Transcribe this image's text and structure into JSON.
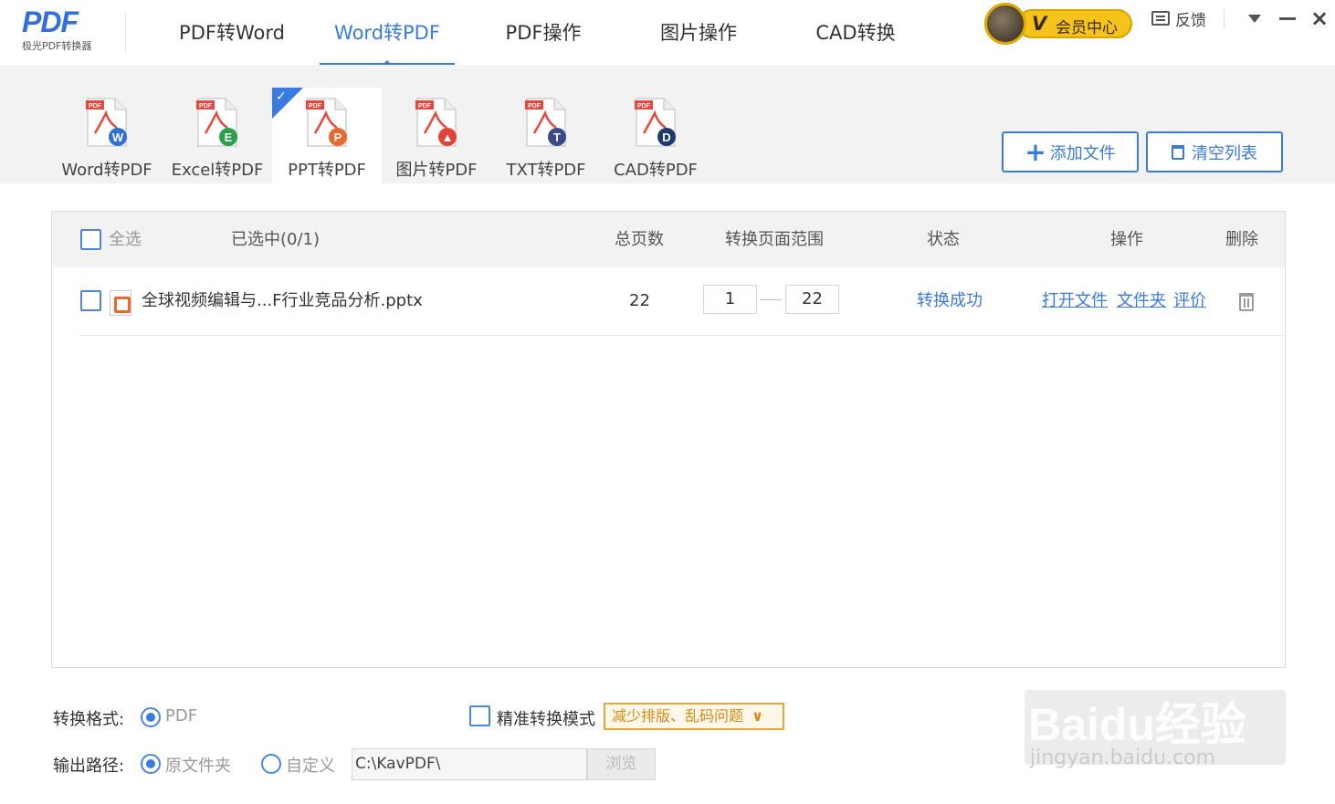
{
  "header": {
    "logo_main": "PDF",
    "logo_sub": "极光PDF转换器",
    "tabs": [
      "PDF转Word",
      "Word转PDF",
      "PDF操作",
      "图片操作",
      "CAD转换"
    ],
    "active_tab": 1,
    "vip_v": "V",
    "vip_label": "会员中心",
    "feedback_label": "反馈"
  },
  "subtabs": {
    "items": [
      {
        "label": "Word转PDF",
        "badge": "W",
        "color": "#2f6fd6"
      },
      {
        "label": "Excel转PDF",
        "badge": "E",
        "color": "#2aa04a"
      },
      {
        "label": "PPT转PDF",
        "badge": "P",
        "color": "#e8692e"
      },
      {
        "label": "图片转PDF",
        "badge": "▲",
        "color": "#e0443c"
      },
      {
        "label": "TXT转PDF",
        "badge": "T",
        "color": "#3b4a8a"
      },
      {
        "label": "CAD转PDF",
        "badge": "D",
        "color": "#1f3a6a"
      }
    ],
    "active": 2,
    "doc_tag": "PDF",
    "accent_color": "#3a7be0"
  },
  "toolbar": {
    "add_label": "添加文件",
    "clear_label": "清空列表"
  },
  "list": {
    "headers": {
      "select_all": "全选",
      "selected": "已选中(0/1)",
      "pages": "总页数",
      "range": "转换页面范围",
      "status": "状态",
      "actions": "操作",
      "delete": "删除"
    },
    "rows": [
      {
        "filename": "全球视频编辑与...F行业竞品分析.pptx",
        "pages": "22",
        "range_start": "1",
        "range_end": "22",
        "status": "转换成功",
        "action_open": "打开文件",
        "action_folder": "文件夹",
        "action_rate": "评价"
      }
    ]
  },
  "options": {
    "format_label": "转换格式:",
    "format_value": "PDF",
    "accurate_label": "精准转换模式",
    "accurate_tag": "减少排版、乱码问题",
    "output_label": "输出路径:",
    "output_original": "原文件夹",
    "output_custom": "自定义",
    "output_path": "C:\\KavPDF\\",
    "browse_label": "浏览"
  },
  "watermark": {
    "brand": "Baidu经验",
    "sub": "jingyan.baidu.com"
  }
}
